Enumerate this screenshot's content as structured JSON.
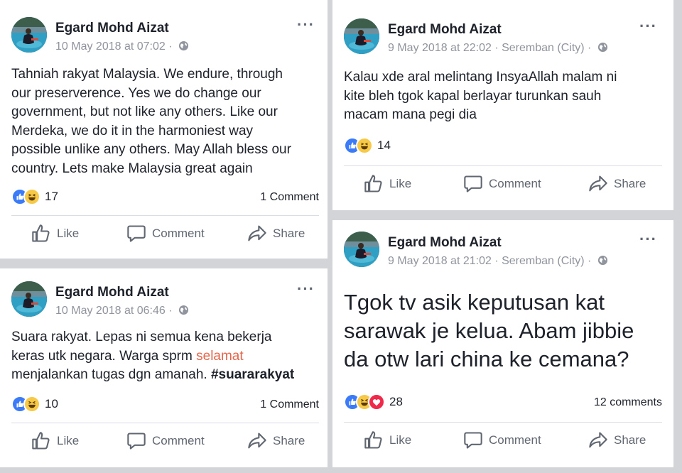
{
  "posts": [
    {
      "author": "Egard Mohd Aizat",
      "date": "10 May 2018 at 07:02",
      "location": "",
      "text_lines": [
        "Tahniah rakyat Malaysia. We endure, through",
        "our preserverence. Yes we do change our",
        "government, but not like any others. Like our",
        "Merdeka, we do it in the harmoniest way",
        "possible unlike any others. May Allah bless our",
        "country. Lets make Malaysia great again"
      ],
      "reaction_count": "17",
      "comment_count": "1 Comment"
    },
    {
      "author": "Egard Mohd Aizat",
      "date": "10 May 2018 at 06:46",
      "location": "",
      "text_line1": "Suara rakyat. Lepas ni semua kena bekerja",
      "text_line2": "keras utk negara. Warga sprm ",
      "text_highlight": "selamat",
      "text_line3": "menjalankan tugas dgn amanah. ",
      "hashtag": "#suararakyat",
      "reaction_count": "10",
      "comment_count": "1 Comment"
    },
    {
      "author": "Egard Mohd Aizat",
      "date": "9 May 2018 at 22:02",
      "location": "Seremban (City)",
      "text_lines": [
        "Kalau xde aral melintang InsyaAllah malam ni",
        "kite bleh tgok kapal berlayar turunkan sauh",
        "macam mana pegi dia"
      ],
      "reaction_count": "14",
      "comment_count": ""
    },
    {
      "author": "Egard Mohd Aizat",
      "date": "9 May 2018 at 21:02",
      "location": "Seremban (City)",
      "text_lines": [
        "Tgok tv asik keputusan kat",
        "sarawak je kelua. Abam jibbie",
        "da otw lari china ke cemana?"
      ],
      "reaction_count": "28",
      "comment_count": "12 comments"
    }
  ],
  "meta_separator": " · ",
  "actions": {
    "like": "Like",
    "comment": "Comment",
    "share": "Share"
  },
  "icons": [
    "more-options-icon",
    "globe-icon",
    "like-reaction-icon",
    "haha-reaction-icon",
    "love-reaction-icon",
    "thumbs-up-icon",
    "comment-bubble-icon",
    "share-arrow-icon"
  ],
  "colors": {
    "like_blue": "#3b7bf7",
    "haha_yellow": "#f7c948",
    "love_red": "#f0284a",
    "highlight": "#e4664b",
    "meta_gray": "#90949c"
  }
}
